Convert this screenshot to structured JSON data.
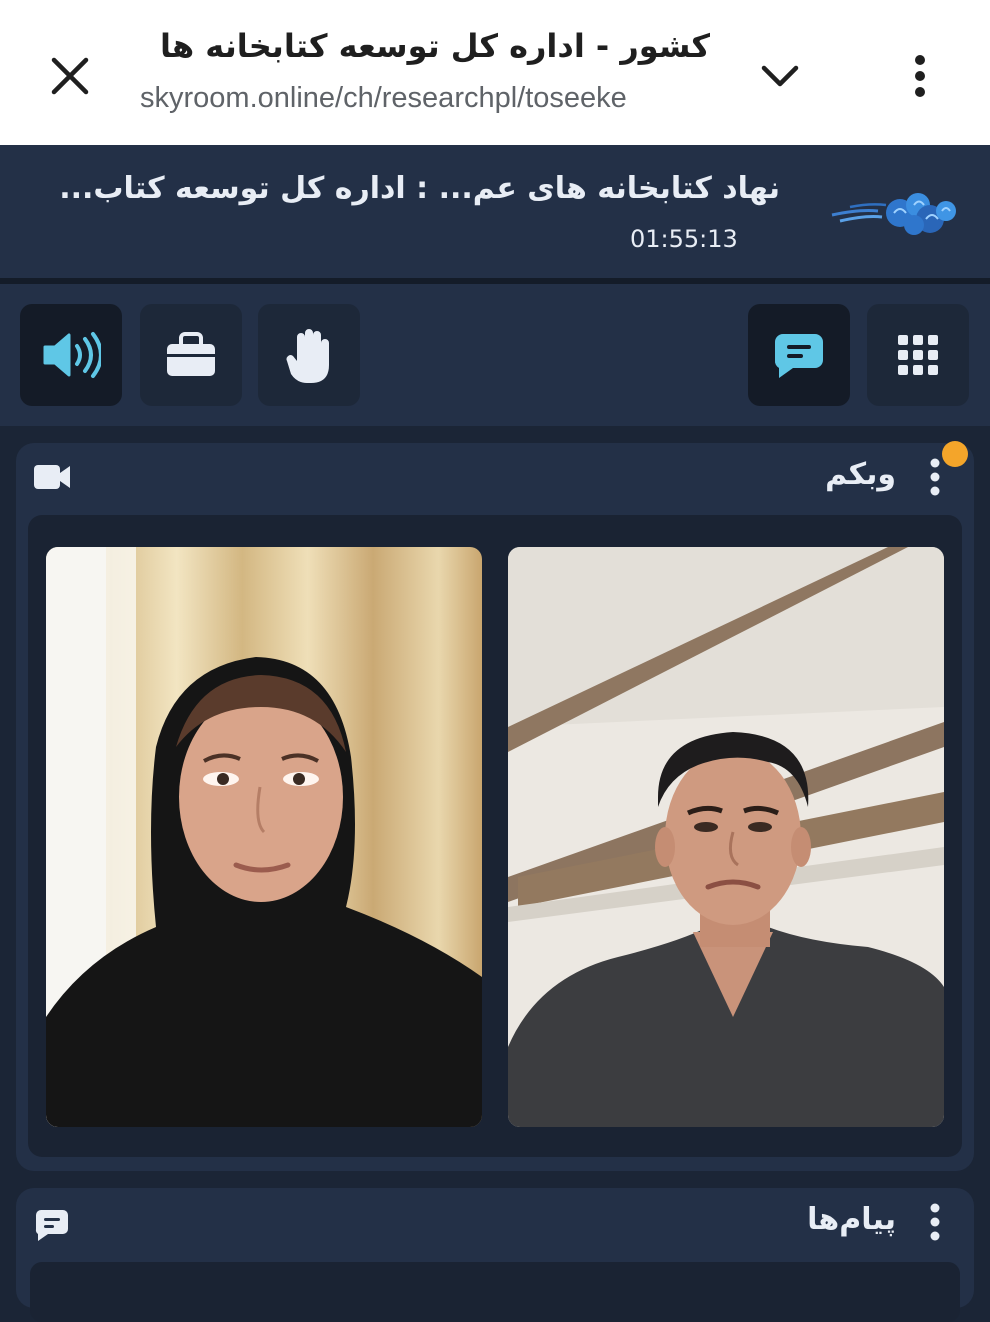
{
  "browser": {
    "title": "کشور - اداره کل توسعه کتابخانه ها",
    "url": "skyroom.online/ch/researchpl/toseeke",
    "icons": [
      "close-icon",
      "chevron-down-icon",
      "more-vertical-icon"
    ]
  },
  "room": {
    "name": "نهاد کتابخانه های عم...  : اداره کل توسعه کتاب...",
    "timer": "01:55:13",
    "logo": "cloud-logo"
  },
  "toolbar": {
    "left_buttons": [
      "speaker-icon",
      "briefcase-icon",
      "raise-hand-icon"
    ],
    "right_buttons": [
      "chat-icon",
      "apps-grid-icon"
    ]
  },
  "webcam_panel": {
    "title": "وبکم",
    "icons": [
      "video-camera-icon",
      "more-vertical-icon"
    ],
    "notification_color": "#f4a52a",
    "participants": [
      "woman-participant-video",
      "man-participant-video"
    ]
  },
  "messages_panel": {
    "title": "پیام‌ها",
    "icons": [
      "chat-icon",
      "more-vertical-icon"
    ]
  },
  "colors": {
    "background": "#1b2536",
    "panel": "#233047",
    "accent": "#5fc7e6",
    "text": "#e8edf5"
  }
}
